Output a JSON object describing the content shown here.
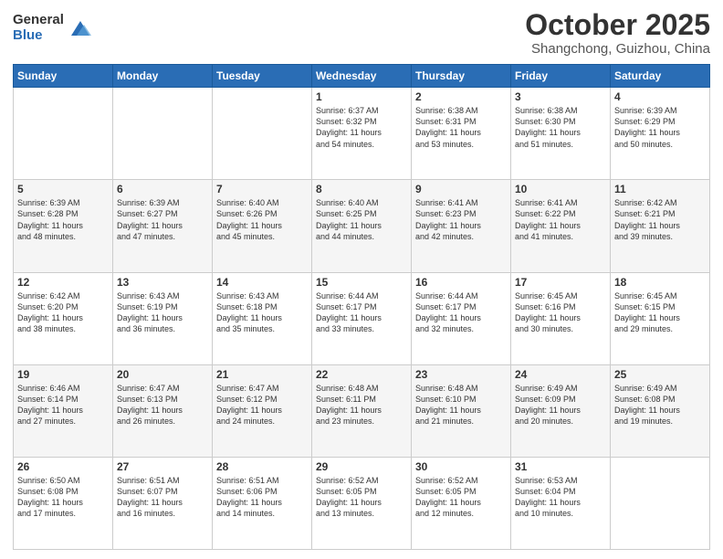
{
  "header": {
    "logo_general": "General",
    "logo_blue": "Blue",
    "month": "October 2025",
    "location": "Shangchong, Guizhou, China"
  },
  "weekdays": [
    "Sunday",
    "Monday",
    "Tuesday",
    "Wednesday",
    "Thursday",
    "Friday",
    "Saturday"
  ],
  "weeks": [
    [
      {
        "day": "",
        "info": ""
      },
      {
        "day": "",
        "info": ""
      },
      {
        "day": "",
        "info": ""
      },
      {
        "day": "1",
        "info": "Sunrise: 6:37 AM\nSunset: 6:32 PM\nDaylight: 11 hours\nand 54 minutes."
      },
      {
        "day": "2",
        "info": "Sunrise: 6:38 AM\nSunset: 6:31 PM\nDaylight: 11 hours\nand 53 minutes."
      },
      {
        "day": "3",
        "info": "Sunrise: 6:38 AM\nSunset: 6:30 PM\nDaylight: 11 hours\nand 51 minutes."
      },
      {
        "day": "4",
        "info": "Sunrise: 6:39 AM\nSunset: 6:29 PM\nDaylight: 11 hours\nand 50 minutes."
      }
    ],
    [
      {
        "day": "5",
        "info": "Sunrise: 6:39 AM\nSunset: 6:28 PM\nDaylight: 11 hours\nand 48 minutes."
      },
      {
        "day": "6",
        "info": "Sunrise: 6:39 AM\nSunset: 6:27 PM\nDaylight: 11 hours\nand 47 minutes."
      },
      {
        "day": "7",
        "info": "Sunrise: 6:40 AM\nSunset: 6:26 PM\nDaylight: 11 hours\nand 45 minutes."
      },
      {
        "day": "8",
        "info": "Sunrise: 6:40 AM\nSunset: 6:25 PM\nDaylight: 11 hours\nand 44 minutes."
      },
      {
        "day": "9",
        "info": "Sunrise: 6:41 AM\nSunset: 6:23 PM\nDaylight: 11 hours\nand 42 minutes."
      },
      {
        "day": "10",
        "info": "Sunrise: 6:41 AM\nSunset: 6:22 PM\nDaylight: 11 hours\nand 41 minutes."
      },
      {
        "day": "11",
        "info": "Sunrise: 6:42 AM\nSunset: 6:21 PM\nDaylight: 11 hours\nand 39 minutes."
      }
    ],
    [
      {
        "day": "12",
        "info": "Sunrise: 6:42 AM\nSunset: 6:20 PM\nDaylight: 11 hours\nand 38 minutes."
      },
      {
        "day": "13",
        "info": "Sunrise: 6:43 AM\nSunset: 6:19 PM\nDaylight: 11 hours\nand 36 minutes."
      },
      {
        "day": "14",
        "info": "Sunrise: 6:43 AM\nSunset: 6:18 PM\nDaylight: 11 hours\nand 35 minutes."
      },
      {
        "day": "15",
        "info": "Sunrise: 6:44 AM\nSunset: 6:17 PM\nDaylight: 11 hours\nand 33 minutes."
      },
      {
        "day": "16",
        "info": "Sunrise: 6:44 AM\nSunset: 6:17 PM\nDaylight: 11 hours\nand 32 minutes."
      },
      {
        "day": "17",
        "info": "Sunrise: 6:45 AM\nSunset: 6:16 PM\nDaylight: 11 hours\nand 30 minutes."
      },
      {
        "day": "18",
        "info": "Sunrise: 6:45 AM\nSunset: 6:15 PM\nDaylight: 11 hours\nand 29 minutes."
      }
    ],
    [
      {
        "day": "19",
        "info": "Sunrise: 6:46 AM\nSunset: 6:14 PM\nDaylight: 11 hours\nand 27 minutes."
      },
      {
        "day": "20",
        "info": "Sunrise: 6:47 AM\nSunset: 6:13 PM\nDaylight: 11 hours\nand 26 minutes."
      },
      {
        "day": "21",
        "info": "Sunrise: 6:47 AM\nSunset: 6:12 PM\nDaylight: 11 hours\nand 24 minutes."
      },
      {
        "day": "22",
        "info": "Sunrise: 6:48 AM\nSunset: 6:11 PM\nDaylight: 11 hours\nand 23 minutes."
      },
      {
        "day": "23",
        "info": "Sunrise: 6:48 AM\nSunset: 6:10 PM\nDaylight: 11 hours\nand 21 minutes."
      },
      {
        "day": "24",
        "info": "Sunrise: 6:49 AM\nSunset: 6:09 PM\nDaylight: 11 hours\nand 20 minutes."
      },
      {
        "day": "25",
        "info": "Sunrise: 6:49 AM\nSunset: 6:08 PM\nDaylight: 11 hours\nand 19 minutes."
      }
    ],
    [
      {
        "day": "26",
        "info": "Sunrise: 6:50 AM\nSunset: 6:08 PM\nDaylight: 11 hours\nand 17 minutes."
      },
      {
        "day": "27",
        "info": "Sunrise: 6:51 AM\nSunset: 6:07 PM\nDaylight: 11 hours\nand 16 minutes."
      },
      {
        "day": "28",
        "info": "Sunrise: 6:51 AM\nSunset: 6:06 PM\nDaylight: 11 hours\nand 14 minutes."
      },
      {
        "day": "29",
        "info": "Sunrise: 6:52 AM\nSunset: 6:05 PM\nDaylight: 11 hours\nand 13 minutes."
      },
      {
        "day": "30",
        "info": "Sunrise: 6:52 AM\nSunset: 6:05 PM\nDaylight: 11 hours\nand 12 minutes."
      },
      {
        "day": "31",
        "info": "Sunrise: 6:53 AM\nSunset: 6:04 PM\nDaylight: 11 hours\nand 10 minutes."
      },
      {
        "day": "",
        "info": ""
      }
    ]
  ]
}
